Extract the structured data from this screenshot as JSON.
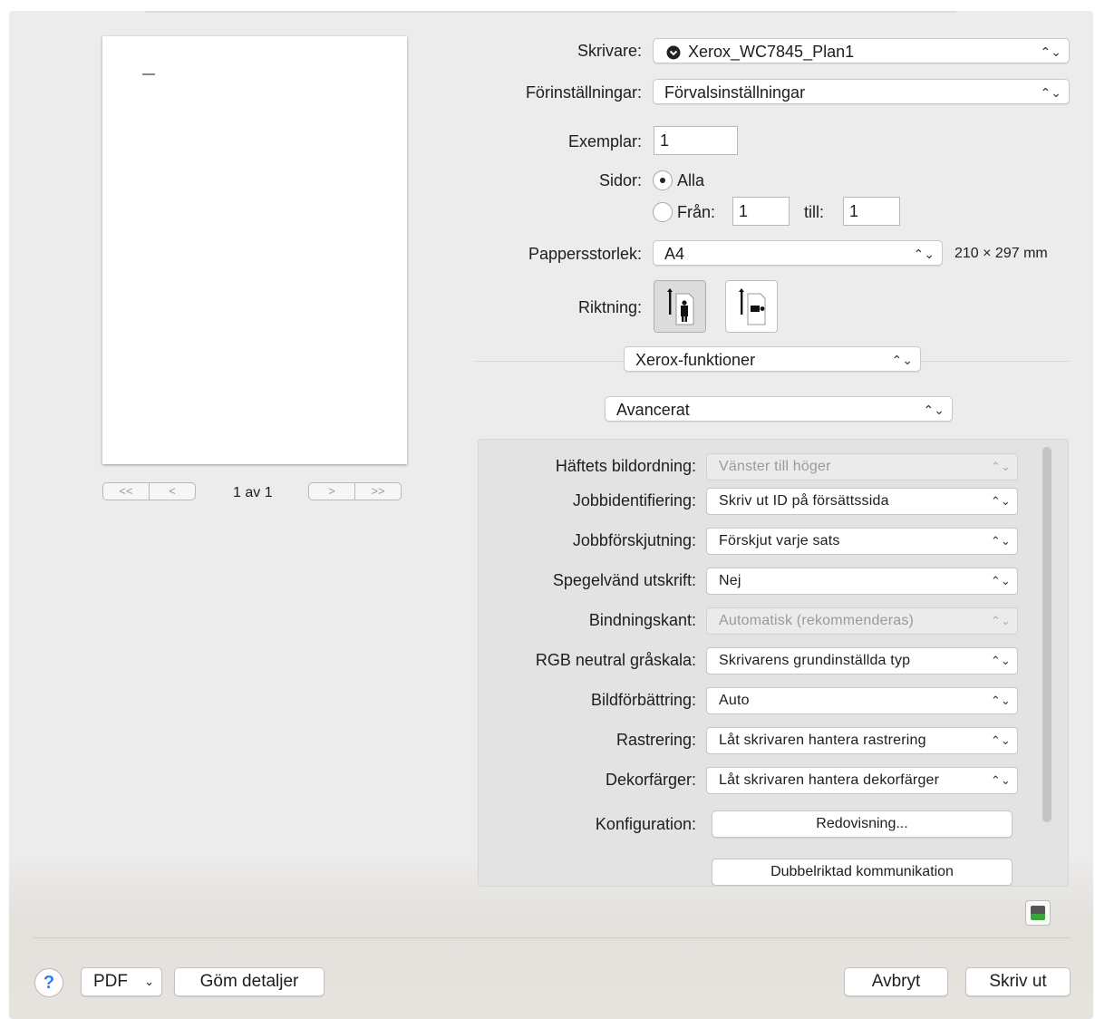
{
  "preview": {
    "page_indicator": "1 av 1",
    "nav": [
      "<<",
      "<",
      ">",
      ">>"
    ]
  },
  "printer": {
    "label": "Skrivare:",
    "value": "Xerox_WC7845_Plan1",
    "icon": "printer-status-icon"
  },
  "presets": {
    "label": "Förinställningar:",
    "value": "Förvalsinställningar"
  },
  "copies": {
    "label": "Exemplar:",
    "value": "1"
  },
  "pages": {
    "label": "Sidor:",
    "all_label": "Alla",
    "from_label": "Från:",
    "from_value": "1",
    "to_label": "till:",
    "to_value": "1",
    "selected": "all"
  },
  "paper_size": {
    "label": "Pappersstorlek:",
    "value": "A4",
    "dimensions": "210 × 297 mm"
  },
  "orientation": {
    "label": "Riktning:",
    "selected": "portrait"
  },
  "section_popup": {
    "value": "Xerox-funktioner"
  },
  "subsection_popup": {
    "value": "Avancerat"
  },
  "advanced": {
    "rows": [
      {
        "label": "Häftets bildordning:",
        "value": "Vänster till höger",
        "disabled": true
      },
      {
        "label": "Jobbidentifiering:",
        "value": "Skriv ut ID på försättssida",
        "disabled": false
      },
      {
        "label": "Jobbförskjutning:",
        "value": "Förskjut varje sats",
        "disabled": false
      },
      {
        "label": "Spegelvänd utskrift:",
        "value": "Nej",
        "disabled": false
      },
      {
        "label": "Bindningskant:",
        "value": "Automatisk (rekommenderas)",
        "disabled": true
      },
      {
        "label": "RGB neutral gråskala:",
        "value": "Skrivarens grundinställda typ",
        "disabled": false
      },
      {
        "label": "Bildförbättring:",
        "value": "Auto",
        "disabled": false
      },
      {
        "label": "Rastrering:",
        "value": "Låt skrivaren hantera rastrering",
        "disabled": false
      },
      {
        "label": "Dekorfärger:",
        "value": "Låt skrivaren hantera dekorfärger",
        "disabled": false
      }
    ],
    "config_label": "Konfiguration:",
    "accounting_button": "Redovisning...",
    "bidirectional_button": "Dubbelriktad kommunikation"
  },
  "footer": {
    "help": "?",
    "pdf": "PDF",
    "hide_details": "Göm detaljer",
    "cancel": "Avbryt",
    "print": "Skriv ut"
  }
}
